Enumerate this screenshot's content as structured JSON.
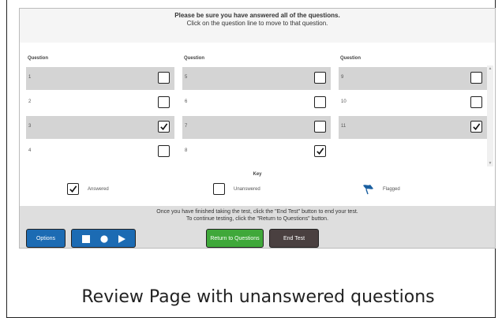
{
  "header": {
    "line1": "Please be sure you have answered all of the questions.",
    "line2": "Click on the question line to move to that question."
  },
  "columns": [
    {
      "heading": "Question",
      "rows": [
        {
          "num": "1",
          "checked": false
        },
        {
          "num": "2",
          "checked": false
        },
        {
          "num": "3",
          "checked": true
        },
        {
          "num": "4",
          "checked": false
        }
      ]
    },
    {
      "heading": "Question",
      "rows": [
        {
          "num": "5",
          "checked": false
        },
        {
          "num": "6",
          "checked": false
        },
        {
          "num": "7",
          "checked": false
        },
        {
          "num": "8",
          "checked": true
        }
      ]
    },
    {
      "heading": "Question",
      "rows": [
        {
          "num": "9",
          "checked": false
        },
        {
          "num": "10",
          "checked": false
        },
        {
          "num": "11",
          "checked": true
        }
      ]
    }
  ],
  "key": {
    "title": "Key",
    "answered": "Answered",
    "unanswered": "Unanswered",
    "flagged": "Flagged"
  },
  "footer": {
    "line1": "Once you have finished taking the test, click the \"End Test\" button to end your test.",
    "line2": "To continue testing, click the \"Return to Questions\" button."
  },
  "buttons": {
    "options": "Options",
    "return": "Return to Questions",
    "end": "End Test"
  },
  "colors": {
    "blue": "#1c6bb3",
    "green": "#3fa83a",
    "dark": "#4a4040",
    "flag": "#1a5fa0"
  },
  "caption": "Review Page with unanswered questions"
}
